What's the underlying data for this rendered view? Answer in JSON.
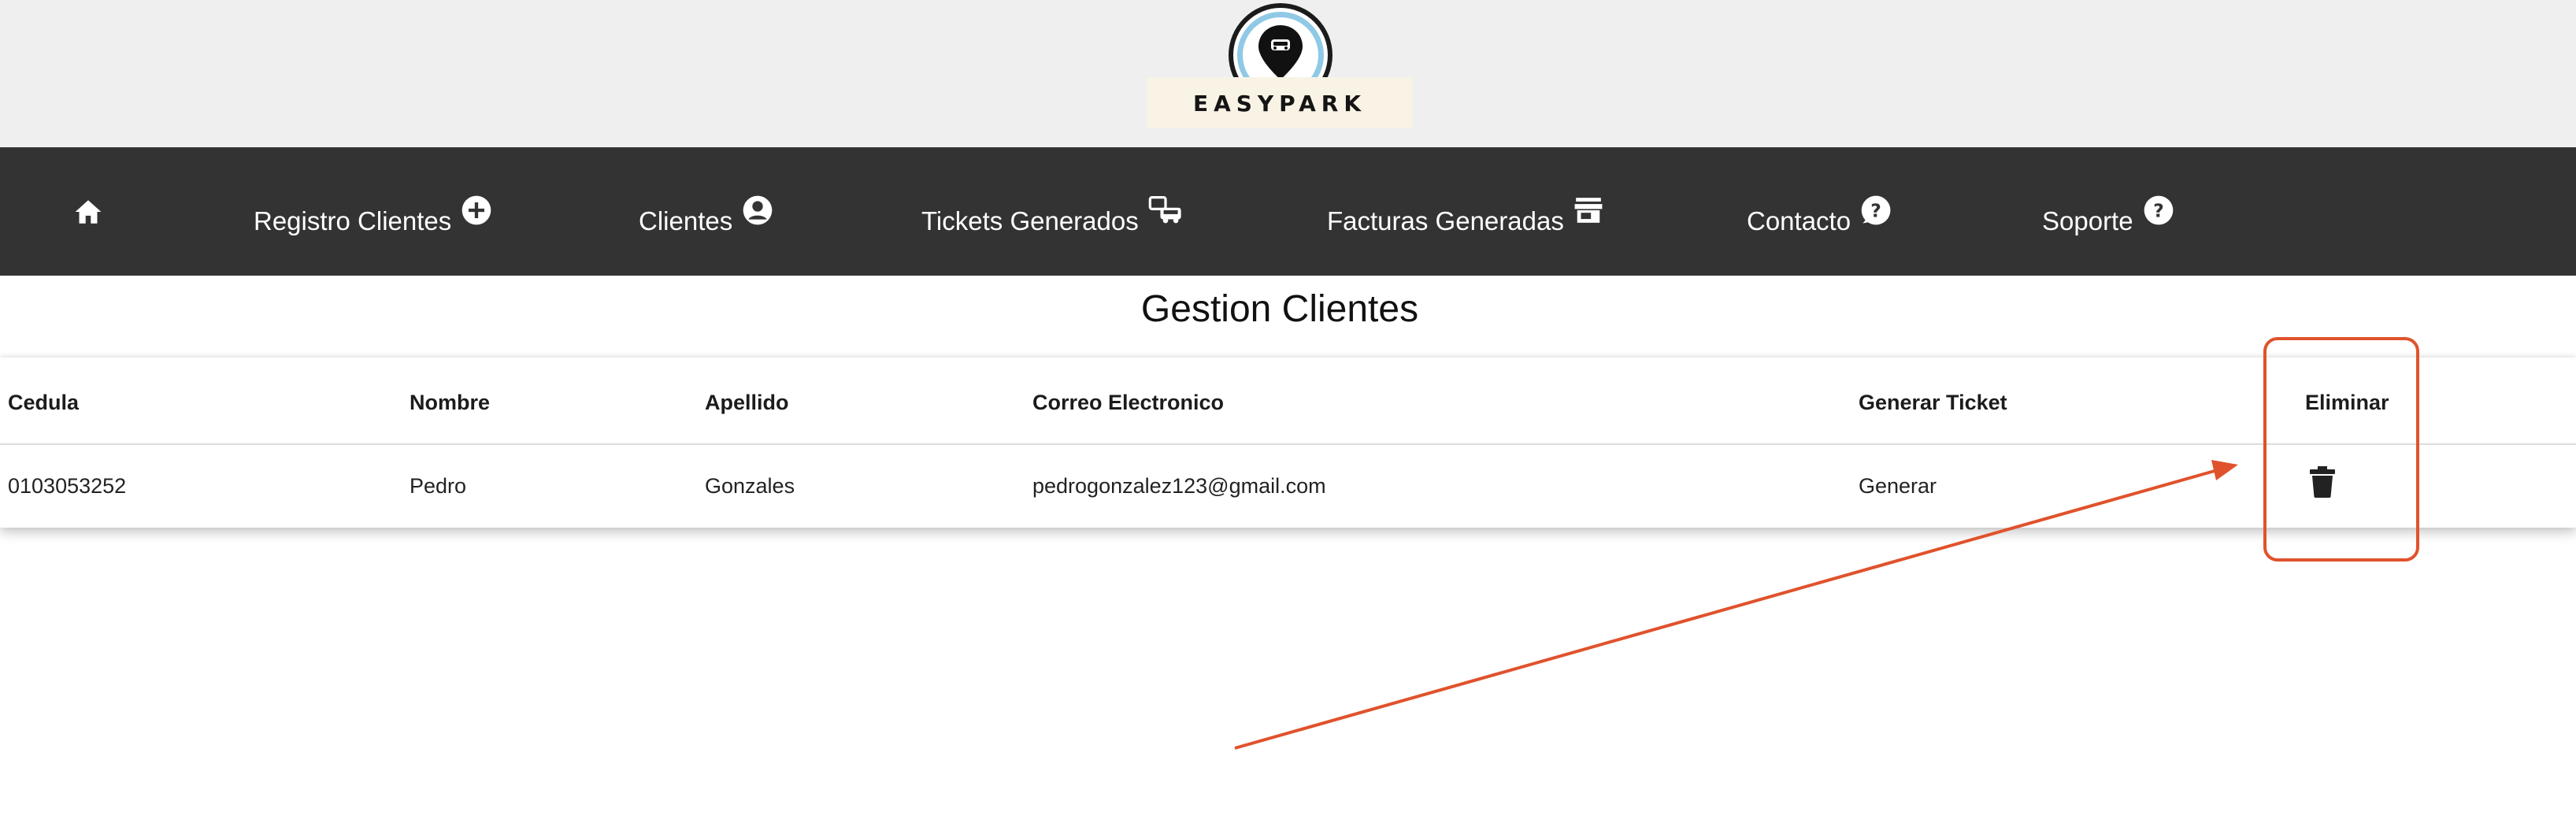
{
  "brand": {
    "name": "EASYPARK"
  },
  "nav": {
    "items": [
      {
        "label": "",
        "icon": "home-icon"
      },
      {
        "label": "Registro Clientes",
        "icon": "add-circle-icon"
      },
      {
        "label": "Clientes",
        "icon": "account-circle-icon"
      },
      {
        "label": "Tickets Generados",
        "icon": "car-ticket-icon"
      },
      {
        "label": "Facturas Generadas",
        "icon": "store-icon"
      },
      {
        "label": "Contacto",
        "icon": "question-bubble-icon"
      },
      {
        "label": "Soporte",
        "icon": "help-circle-icon"
      }
    ]
  },
  "page": {
    "title": "Gestion Clientes"
  },
  "table": {
    "headers": [
      "Cedula",
      "Nombre",
      "Apellido",
      "Correo Electronico",
      "Generar Ticket",
      "Eliminar"
    ],
    "rows": [
      {
        "cedula": "0103053252",
        "nombre": "Pedro",
        "apellido": "Gonzales",
        "correo": "pedrogonzalez123@gmail.com",
        "generar": "Generar",
        "eliminar_icon": "trash-icon"
      }
    ]
  },
  "annotation": {
    "color": "#e0522c"
  },
  "colors": {
    "nav_bg": "#333333",
    "header_bg": "#efefef",
    "accent": "#e0522c"
  }
}
